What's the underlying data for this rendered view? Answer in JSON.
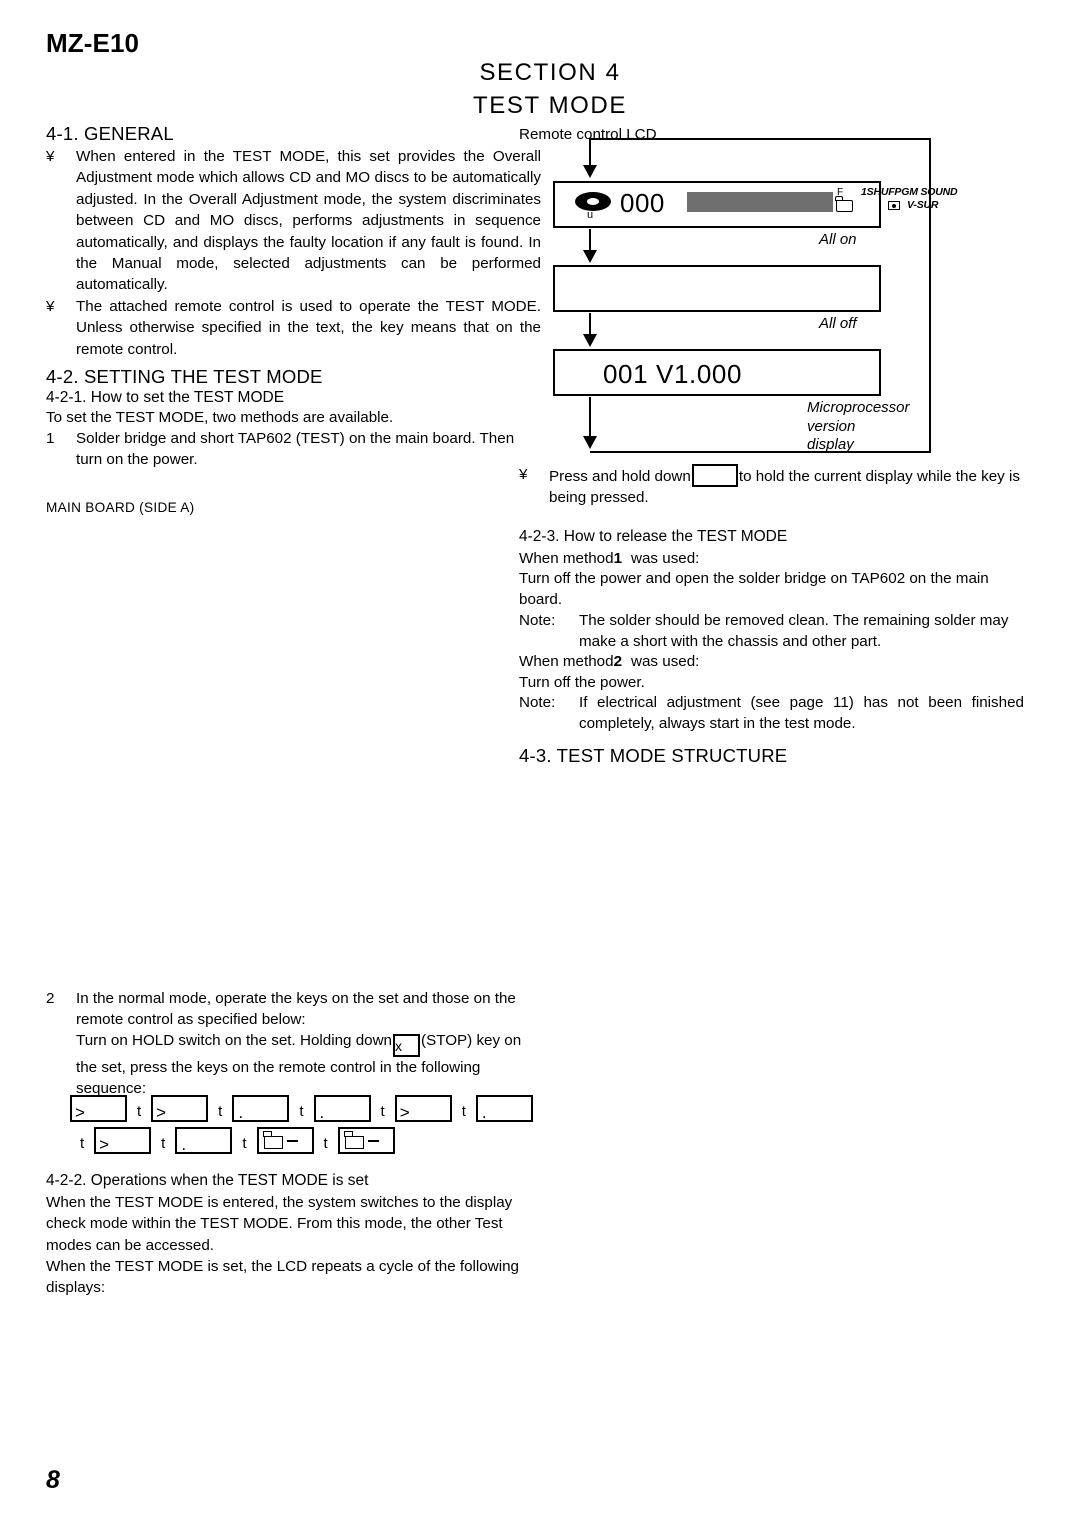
{
  "header": {
    "model": "MZ-E10",
    "section_line1": "SECTION 4",
    "section_line2": "TEST MODE"
  },
  "left_column": {
    "s41_heading": "4-1. GENERAL",
    "s41_bullets": [
      "When entered in the TEST MODE, this set provides the Overall Adjustment mode which allows CD and MO discs to be automatically adjusted. In the Overall Adjustment mode, the system discriminates between CD and MO discs, performs adjustments in sequence automatically, and displays the faulty location if any fault is found. In the Manual mode, selected adjustments can be performed automatically.",
      "The attached remote control is used to operate the TEST MODE. Unless otherwise specified in the text, the key means that on the remote control."
    ],
    "bullet_mark": "¥",
    "s42_heading": "4-2. SETTING THE TEST MODE",
    "s421_heading": "4-2-1. How to set the TEST MODE",
    "s421_intro": "To set the TEST MODE, two methods are available.",
    "step1_number": "1",
    "step1_text": "Solder bridge and short TAP602 (TEST) on the main board. Then turn on the power.",
    "main_board_label": "MAIN BOARD  (SIDE A)",
    "step2_number": "2",
    "step2_text": "In the normal mode, operate the keys on the set and those on the remote control as specified below:",
    "step2_para_a": "Turn on HOLD switch on the set. Holding down",
    "step2_para_a_tail": "(STOP)",
    "step2_para_b": "key on the set, press the keys on the remote control in the following sequence:",
    "key_sequence_row1": [
      {
        "glyph": "gt"
      },
      {
        "glyph": "gt"
      },
      {
        "glyph": "dot"
      },
      {
        "glyph": "dot"
      },
      {
        "glyph": "gt"
      },
      {
        "glyph": "dot"
      }
    ],
    "key_sequence_row2": [
      {
        "glyph": "gt"
      },
      {
        "glyph": "dot"
      },
      {
        "glyph": "folder-dash"
      },
      {
        "glyph": "folder-dash"
      }
    ],
    "sequence_arrow": "t",
    "s422_heading": "4-2-2. Operations when the TEST MODE is set",
    "s422_para1": "When the TEST MODE is entered, the system switches to the display check mode within the TEST MODE. From this mode, the other Test modes can be accessed.",
    "s422_para2": "When the TEST MODE is set, the LCD repeats a cycle of the following displays:"
  },
  "right_column": {
    "lcd_caption": "Remote control LCD",
    "flow": {
      "box1": {
        "number": "000",
        "sub_u": "u",
        "f_label": "F",
        "indicator_top": "1SHUFPGM SOUND",
        "indicator_bottom": "V-SUR"
      },
      "box1_side_label": "All on",
      "box2_side_label": "All off",
      "box3": {
        "text": "001  V1.000"
      },
      "box3_side_label_lines": [
        "Microprocessor",
        "version",
        "display"
      ]
    },
    "hold_bullet_mark": "¥",
    "hold_text_before": "Press and hold down",
    "hold_text_after": "to hold the current display while the key is being pressed.",
    "s423_heading": "4-2-3. How to release the TEST MODE",
    "method1_line": "When method",
    "method1_num": "1",
    "method1_tail": "was used:",
    "method1_body": "Turn off the power and open the solder bridge on TAP602 on the main board.",
    "note1_label": "Note:",
    "note1_text": "The solder should be removed clean. The remaining solder may make a short with the chassis and other part.",
    "method2_line": "When method",
    "method2_num": "2",
    "method2_tail": "was used:",
    "method2_body": "Turn off the power.",
    "note2_label": "Note:",
    "note2_text": "If electrical adjustment (see page 11) has not been finished completely, always start in the test mode.",
    "s43_heading": "4-3. TEST MODE STRUCTURE"
  },
  "footer": {
    "page_number": "8"
  },
  "colors": {
    "ink": "#000000",
    "lcd_bar": "#6e6e6e",
    "paper": "#ffffff"
  }
}
